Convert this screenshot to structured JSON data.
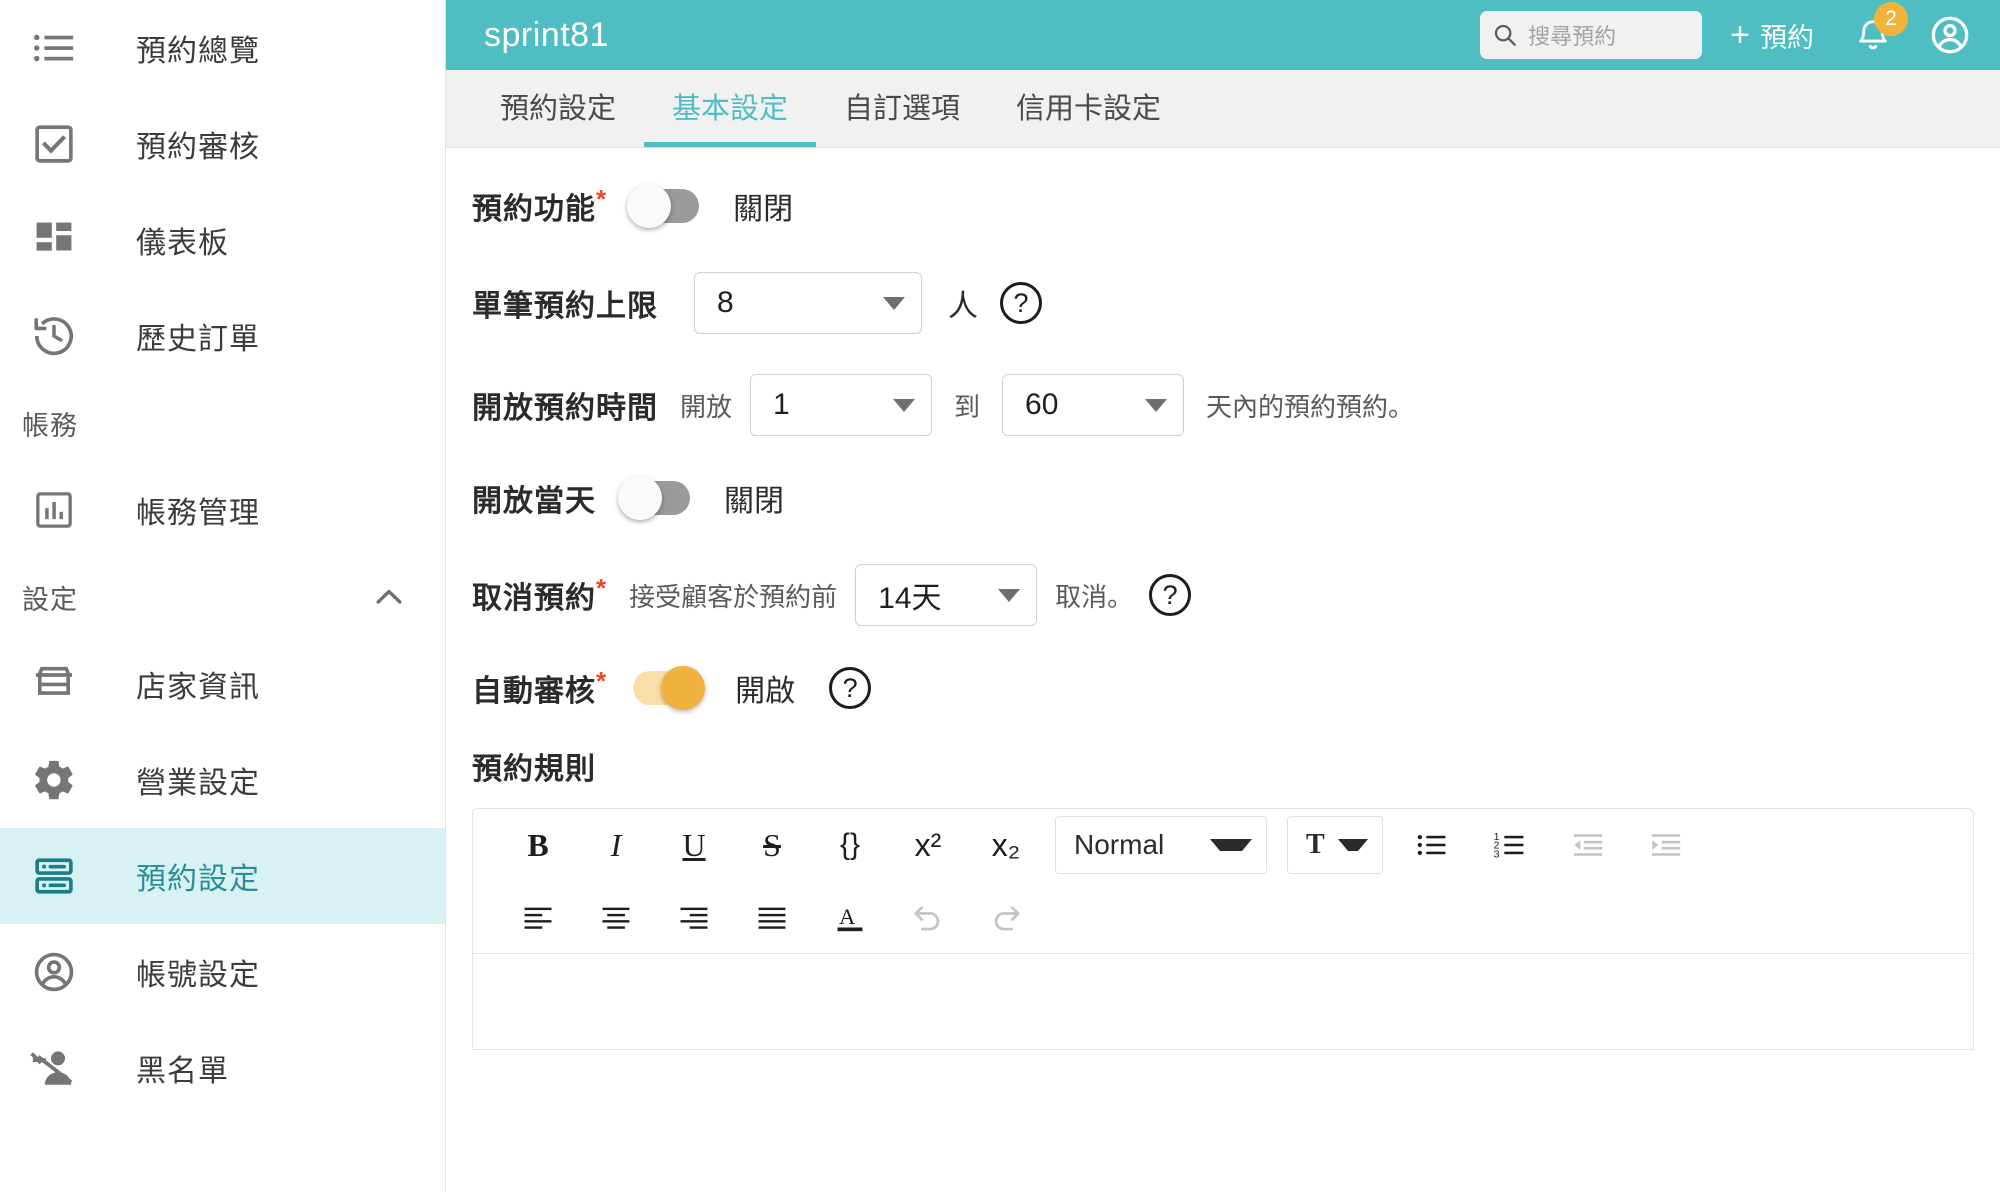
{
  "sidebar": {
    "items": [
      {
        "label": "預約總覽",
        "icon": "list-icon",
        "active": false
      },
      {
        "label": "預約審核",
        "icon": "checkbox-icon",
        "active": false
      },
      {
        "label": "儀表板",
        "icon": "dashboard-icon",
        "active": false
      },
      {
        "label": "歷史訂單",
        "icon": "history-icon",
        "active": false
      }
    ],
    "group_accounting": {
      "label": "帳務"
    },
    "accounting_items": [
      {
        "label": "帳務管理",
        "icon": "chart-bar-icon",
        "active": false
      }
    ],
    "group_settings": {
      "label": "設定",
      "chevron": "chevron-up-icon"
    },
    "settings_items": [
      {
        "label": "店家資訊",
        "icon": "store-icon",
        "active": false
      },
      {
        "label": "營業設定",
        "icon": "gear-icon",
        "active": false
      },
      {
        "label": "預約設定",
        "icon": "reservation-settings-icon",
        "active": true
      },
      {
        "label": "帳號設定",
        "icon": "account-circle-icon",
        "active": false
      },
      {
        "label": "黑名單",
        "icon": "person-off-icon",
        "active": false
      }
    ]
  },
  "topbar": {
    "brand": "sprint81",
    "search": {
      "placeholder": "搜尋預約",
      "value": "",
      "icon": "search-icon"
    },
    "add_button": {
      "label": "預約",
      "plus": "+"
    },
    "notifications": {
      "count": "2",
      "icon": "bell-icon"
    },
    "account": {
      "icon": "account-circle-icon"
    }
  },
  "tabs": [
    {
      "label": "預約設定",
      "active": false
    },
    {
      "label": "基本設定",
      "active": true
    },
    {
      "label": "自訂選項",
      "active": false
    },
    {
      "label": "信用卡設定",
      "active": false
    }
  ],
  "form": {
    "booking_feature": {
      "label": "預約功能",
      "required": "*",
      "toggle_on": false,
      "state_text": "關閉"
    },
    "max_per_booking": {
      "label": "單筆預約上限",
      "value": "8",
      "unit": "人",
      "help": "?"
    },
    "open_period": {
      "label": "開放預約時間",
      "prefix": "開放",
      "from_value": "1",
      "between": "到",
      "to_value": "60",
      "suffix": "天內的預約預約。"
    },
    "open_same_day": {
      "label": "開放當天",
      "toggle_on": false,
      "state_text": "關閉"
    },
    "cancel_booking": {
      "label": "取消預約",
      "required": "*",
      "prefix": "接受顧客於預約前",
      "value": "14天",
      "suffix": "取消。",
      "help": "?"
    },
    "auto_review": {
      "label": "自動審核",
      "required": "*",
      "toggle_on": true,
      "state_text": "開啟",
      "help": "?"
    },
    "rules_title": "預約規則"
  },
  "editor": {
    "toolbar_row1": [
      {
        "name": "bold",
        "glyph": "B"
      },
      {
        "name": "italic",
        "glyph": "I"
      },
      {
        "name": "underline",
        "glyph": "U"
      },
      {
        "name": "strike",
        "glyph": "S"
      },
      {
        "name": "code-block",
        "glyph": "{}"
      },
      {
        "name": "superscript",
        "glyph": "x²"
      },
      {
        "name": "subscript",
        "glyph": "x₂"
      }
    ],
    "format_select": {
      "value": "Normal"
    },
    "font_color_select": {
      "value": "T"
    },
    "toolbar_row1_end": [
      {
        "name": "bullet-list",
        "glyph": "•≡"
      },
      {
        "name": "numbered-list",
        "glyph": "1≡"
      },
      {
        "name": "outdent",
        "glyph": "⇤"
      },
      {
        "name": "indent",
        "glyph": "⇥"
      }
    ],
    "toolbar_row2": [
      {
        "name": "align-left",
        "glyph": "≡"
      },
      {
        "name": "align-center",
        "glyph": "≡"
      },
      {
        "name": "align-right",
        "glyph": "≡"
      },
      {
        "name": "align-justify",
        "glyph": "≡"
      },
      {
        "name": "text-color",
        "glyph": "A"
      },
      {
        "name": "undo",
        "glyph": "↺"
      },
      {
        "name": "redo",
        "glyph": "↻"
      }
    ],
    "content": ""
  },
  "colors": {
    "brand_teal": "#4fbec3",
    "active_nav_bg": "#d8f2f4",
    "active_nav_text": "#2b8d98",
    "badge_orange": "#f2b339",
    "toggle_on": "#f0b13f",
    "required_red": "#f24822"
  }
}
